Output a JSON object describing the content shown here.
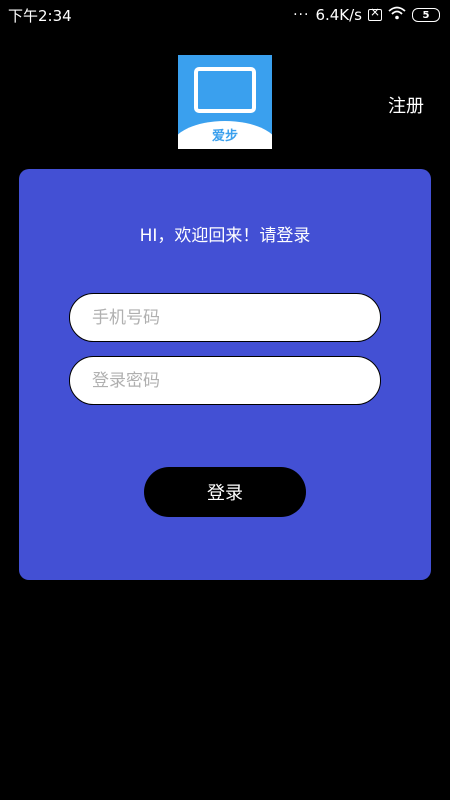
{
  "status_bar": {
    "time": "下午2:34",
    "network_speed": "6.4K/s",
    "battery_level": "5",
    "icons": [
      "signal-dots-icon",
      "mute-icon",
      "wifi-icon",
      "battery-icon"
    ]
  },
  "header": {
    "logo_text": "爱步",
    "register_label": "注册"
  },
  "login_card": {
    "welcome": "HI，欢迎回来！请登录",
    "phone_placeholder": "手机号码",
    "phone_value": "",
    "password_placeholder": "登录密码",
    "password_value": "",
    "login_label": "登录"
  },
  "colors": {
    "background": "#000000",
    "card": "#4350d4",
    "logo": "#3aa0ee",
    "button": "#000000"
  }
}
